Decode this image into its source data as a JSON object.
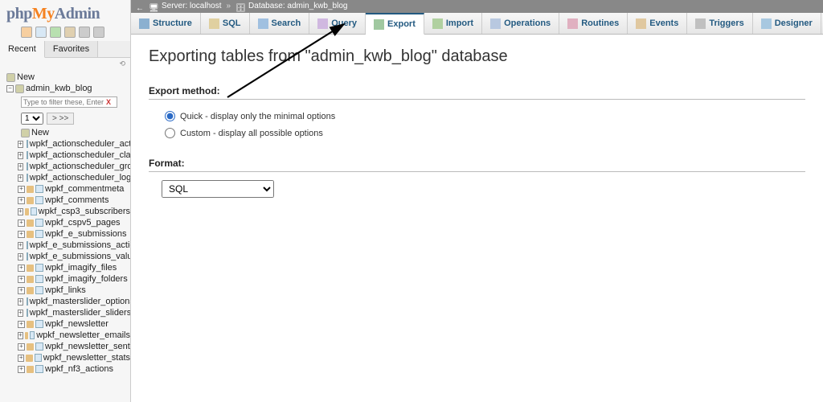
{
  "breadcrumb": {
    "server_label": "Server: localhost",
    "db_label": "Database: admin_kwb_blog",
    "separator": "»"
  },
  "logo": {
    "php": "php",
    "my": "My",
    "admin": "Admin"
  },
  "sidebar": {
    "tabs": {
      "recent": "Recent",
      "favorites": "Favorites"
    },
    "new_label": "New",
    "db_name": "admin_kwb_blog",
    "filter_placeholder": "Type to filter these, Enter to searc",
    "pager": {
      "selected": "1",
      "next": "> >>"
    },
    "tables": [
      "wpkf_actionscheduler_actions",
      "wpkf_actionscheduler_claims",
      "wpkf_actionscheduler_groups",
      "wpkf_actionscheduler_logs",
      "wpkf_commentmeta",
      "wpkf_comments",
      "wpkf_csp3_subscribers",
      "wpkf_cspv5_pages",
      "wpkf_e_submissions",
      "wpkf_e_submissions_actions",
      "wpkf_e_submissions_values",
      "wpkf_imagify_files",
      "wpkf_imagify_folders",
      "wpkf_links",
      "wpkf_masterslider_options",
      "wpkf_masterslider_sliders",
      "wpkf_newsletter",
      "wpkf_newsletter_emails",
      "wpkf_newsletter_sent",
      "wpkf_newsletter_stats",
      "wpkf_nf3_actions"
    ]
  },
  "tabs": {
    "structure": "Structure",
    "sql": "SQL",
    "search": "Search",
    "query": "Query",
    "export": "Export",
    "import": "Import",
    "operations": "Operations",
    "routines": "Routines",
    "events": "Events",
    "triggers": "Triggers",
    "designer": "Designer"
  },
  "page": {
    "heading": "Exporting tables from \"admin_kwb_blog\" database",
    "export_method_label": "Export method:",
    "quick_label": "Quick - display only the minimal options",
    "custom_label": "Custom - display all possible options",
    "format_label": "Format:",
    "format_value": "SQL"
  }
}
